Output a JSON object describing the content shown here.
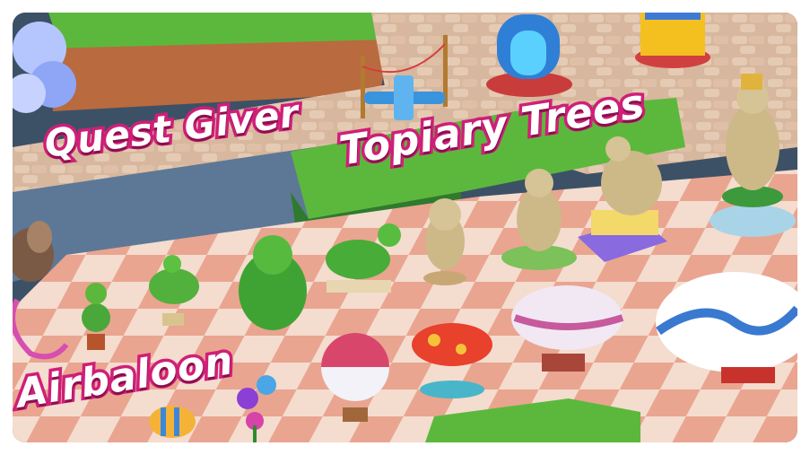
{
  "labels": {
    "quest_giver": "Quest Giver",
    "topiary_trees": "Topiary Trees",
    "airbaloon": "Airbaloon"
  },
  "colors": {
    "label_fill": "#ffffff",
    "label_outline": "#cf1f78",
    "grass": "#5cb83c",
    "floor_light": "#f4dccf",
    "floor_pink": "#e9a590",
    "stone_wall": "#5d7896",
    "statue": "#cdb888"
  },
  "items": {
    "topiary": [
      "potted-topiary-ball",
      "potted-topiary-bird",
      "topiary-lion",
      "topiary-horse"
    ],
    "statues": [
      "elephant-statue",
      "fox-statue",
      "cat-musicians-statue",
      "bear-trumpet-statue"
    ],
    "airships": [
      "hot-air-balloon",
      "polka-dot-airship",
      "striped-blimp",
      "wave-blimp"
    ],
    "other": [
      "flower-balloon-bouquet",
      "fish-toy",
      "blue-airplane-toy",
      "carousel-booth"
    ]
  }
}
